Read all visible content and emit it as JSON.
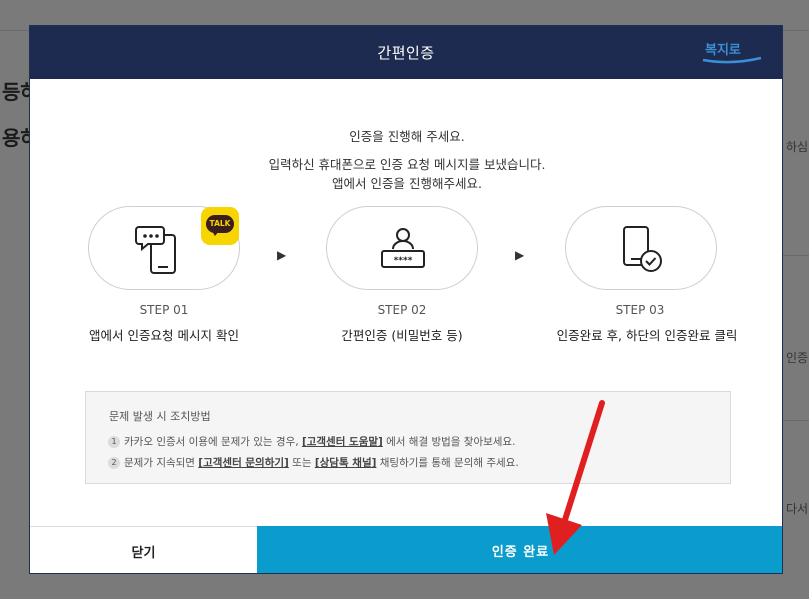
{
  "background": {
    "left_texts": [
      "등하",
      "용하"
    ],
    "right_texts": [
      "하심",
      "인증",
      "다서"
    ]
  },
  "modal": {
    "title": "간편인증",
    "logo_text": "복지로",
    "intro_lines": [
      "인증을 진행해 주세요.",
      "입력하신 휴대폰으로 인증 요청 메시지를 보냈습니다.",
      "앱에서 인증을 진행해주세요."
    ],
    "badge_label": "TALK",
    "steps": [
      {
        "num": "STEP 01",
        "desc": "앱에서 인증요청 메시지 확인",
        "icon": "phone-message-icon"
      },
      {
        "num": "STEP 02",
        "desc": "간편인증 (비밀번호 등)",
        "icon": "user-password-icon"
      },
      {
        "num": "STEP 03",
        "desc": "인증완료 후, 하단의 인증완료 클릭",
        "icon": "phone-check-icon"
      }
    ],
    "step_arrow": "▶",
    "help": {
      "title": "문제 발생 시 조치방법",
      "items": [
        {
          "num": "1",
          "pre": "카카오 인증서 이용에 문제가 있는 경우, ",
          "link1": "[고객센터 도움말]",
          "mid": " 에서 해결 방법을 찾아보세요.",
          "link2": "",
          "post": ""
        },
        {
          "num": "2",
          "pre": "문제가 지속되면 ",
          "link1": "[고객센터 문의하기]",
          "mid": " 또는 ",
          "link2": "[상담톡 채널]",
          "post": " 채팅하기를 통해 문의해 주세요."
        }
      ]
    },
    "buttons": {
      "close": "닫기",
      "complete": "인증 완료"
    }
  },
  "colors": {
    "header_bg": "#1c2b4f",
    "complete_bg": "#0a9ccc",
    "badge_bg": "#f6d500",
    "annotation_arrow": "#e02020"
  }
}
